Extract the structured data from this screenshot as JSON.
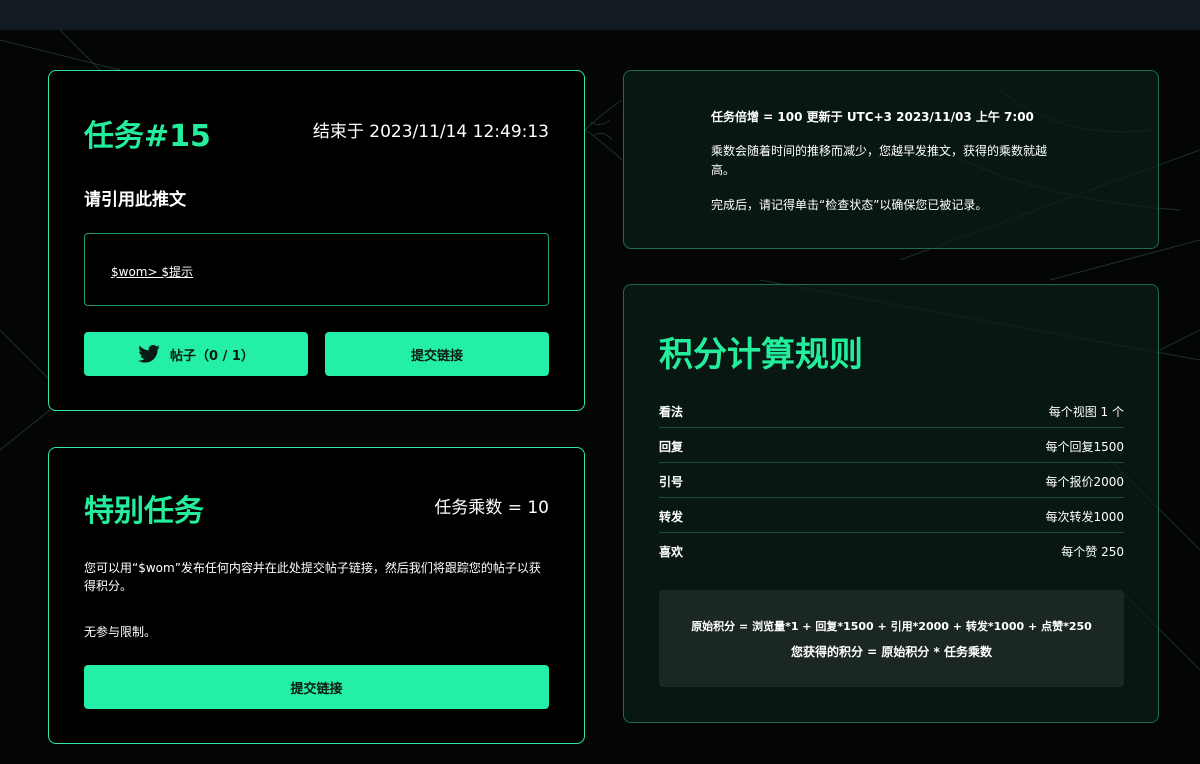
{
  "task_card": {
    "title": "任务#15",
    "end_time": "结束于 2023/11/14 12:49:13",
    "instruction": "请引用此推文",
    "quote_text": "$wom> $提示",
    "post_button": "帖子（0 / 1）",
    "submit_button": "提交链接"
  },
  "special_card": {
    "title": "特别任务",
    "multiplier": "任务乘数 = 10",
    "description": "您可以用“$wom”发布任何内容并在此处提交帖子链接，然后我们将跟踪您的帖子以获得积分。",
    "limit": "无参与限制。",
    "submit_button": "提交链接"
  },
  "info_card": {
    "headline": "任务倍增 = 100 更新于 UTC+3 2023/11/03 上午 7:00",
    "line1": "乘数会随着时间的推移而减少，您越早发推文，获得的乘数就越高。",
    "line2": "完成后，请记得单击“检查状态”以确保您已被记录。"
  },
  "rules_card": {
    "title": "积分计算规则",
    "rows": [
      {
        "key": "看法",
        "value": "每个视图 1 个"
      },
      {
        "key": "回复",
        "value": "每个回复1500"
      },
      {
        "key": "引号",
        "value": "每个报价2000"
      },
      {
        "key": "转发",
        "value": "每次转发1000"
      },
      {
        "key": "喜欢",
        "value": "每个赞 250"
      }
    ],
    "formula1": "原始积分 = 浏览量*1 + 回复*1500 + 引用*2000 + 转发*1000 + 点赞*250",
    "formula2": "您获得的积分 = 原始积分 * 任务乘数"
  },
  "colors": {
    "accent": "#24ee9c",
    "button": "#24efa6",
    "border": "#2ee6a6",
    "background": "#040605",
    "topbar": "#121a22"
  },
  "icons": [
    "twitter-bird-icon"
  ]
}
